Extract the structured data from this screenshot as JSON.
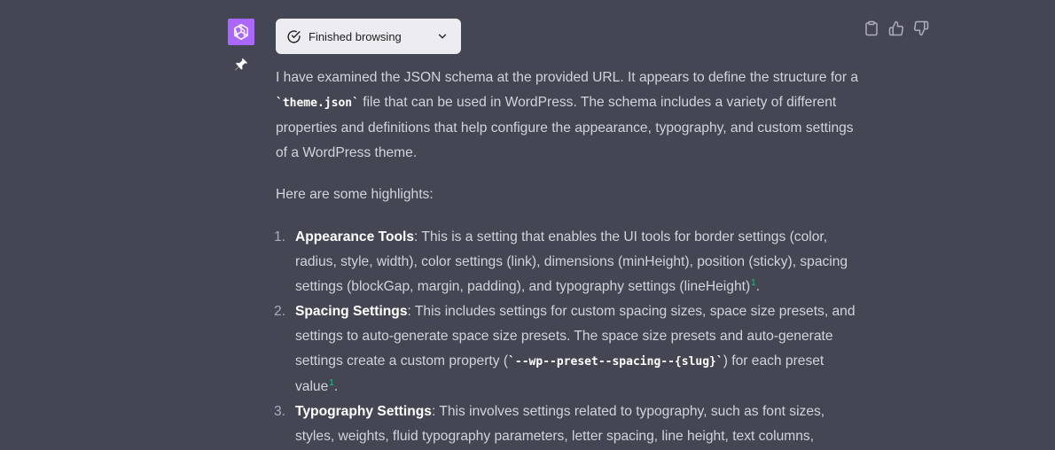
{
  "avatar": {
    "icon": "openai-logo-icon",
    "bg": "#ab68ff"
  },
  "browsing": {
    "label": "Finished browsing"
  },
  "intro": {
    "t1": "I have examined the JSON schema at the provided URL. It appears to define the structure for a ",
    "code": "`theme.json`",
    "t2": " file that can be used in WordPress. The schema includes a variety of different properties and definitions that help configure the appearance, typography, and custom settings of a WordPress theme."
  },
  "highlights_label": "Here are some highlights:",
  "items": [
    {
      "num": "1.",
      "title": "Appearance Tools",
      "text": ": This is a setting that enables the UI tools for border settings (color, radius, style, width), color settings (link), dimensions (minHeight), position (sticky), spacing settings (blockGap, margin, padding), and typography settings (lineHeight)",
      "cite": "1",
      "end": "."
    },
    {
      "num": "2.",
      "title": "Spacing Settings",
      "text": ": This includes settings for custom spacing sizes, space size presets, and settings to auto-generate space size presets. The space size presets and auto-generate settings create a custom property (",
      "code": "`--wp--preset--spacing--{slug}`",
      "text2": ") for each preset value",
      "cite": "1",
      "end": "."
    },
    {
      "num": "3.",
      "title": "Typography Settings",
      "text": ": This involves settings related to typography, such as font sizes, styles, weights, fluid typography parameters, letter spacing, line height, text columns,"
    }
  ],
  "colors": {
    "background": "#444654",
    "text": "#d1d5db",
    "citation": "#19c37d"
  }
}
